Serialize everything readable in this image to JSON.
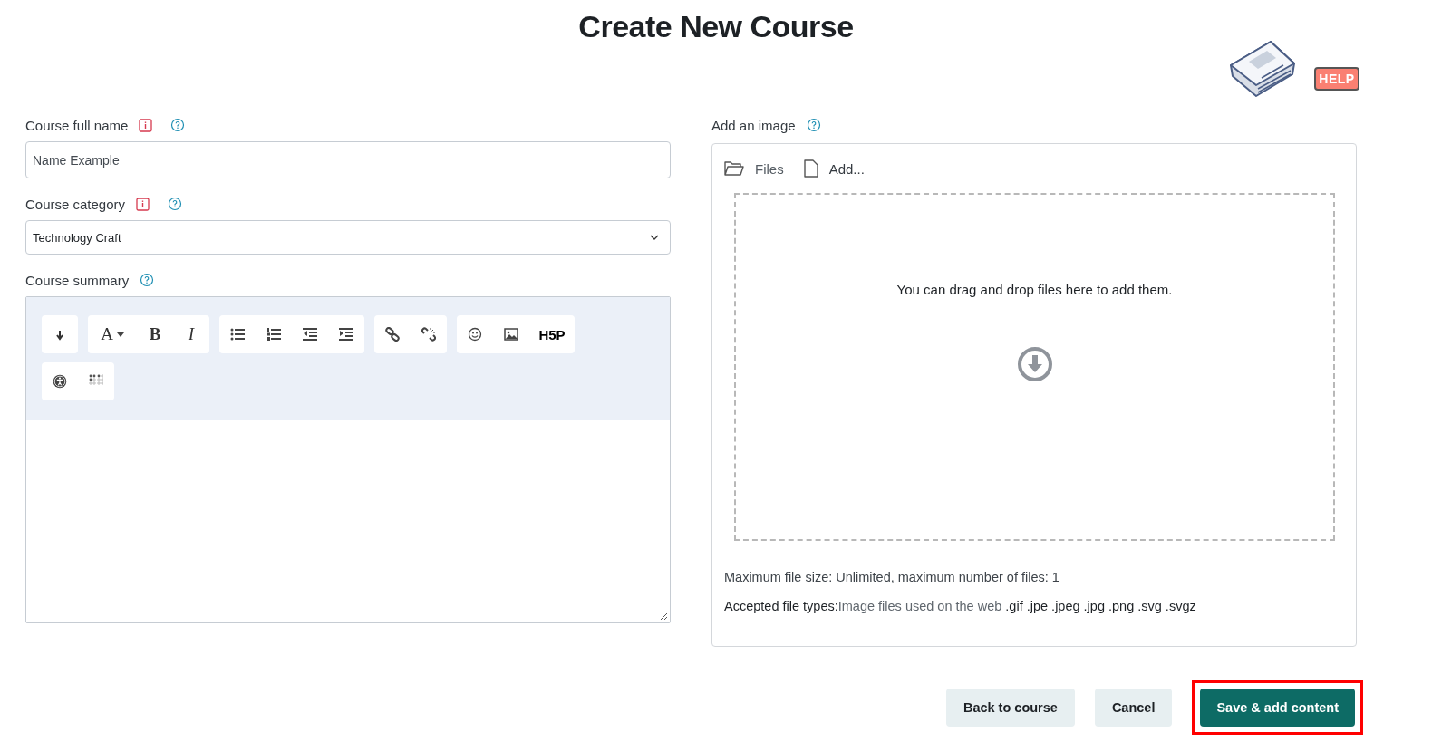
{
  "page": {
    "title": "Create New Course",
    "help_badge": "HELP"
  },
  "fields": [
    {
      "kind": "text",
      "label": "Course full name",
      "required": true,
      "value": "Name Example"
    },
    {
      "kind": "select",
      "label": "Course category",
      "required": true,
      "value": "Technology Craft"
    },
    {
      "kind": "editor",
      "label": "Course summary",
      "toolbar_glyphs": [
        "A",
        "B",
        "I",
        "H5P"
      ]
    }
  ],
  "image_picker": {
    "label": "Add an image",
    "files_link": "Files",
    "add_link": "Add...",
    "drop_hint": "You can drag and drop files here to add them.",
    "max_size_note": "Maximum file size: Unlimited, maximum number of files: 1",
    "accepted_label": "Accepted file types:",
    "accepted_desc": "Image files used on the web",
    "accepted_exts": ".gif .jpe .jpeg .jpg .png .svg .svgz"
  },
  "buttons": [
    {
      "label": "Back to course",
      "kind": "secondary",
      "highlighted": false
    },
    {
      "label": "Cancel",
      "kind": "secondary",
      "highlighted": false
    },
    {
      "label": "Save & add content",
      "kind": "primary",
      "highlighted": true
    }
  ]
}
